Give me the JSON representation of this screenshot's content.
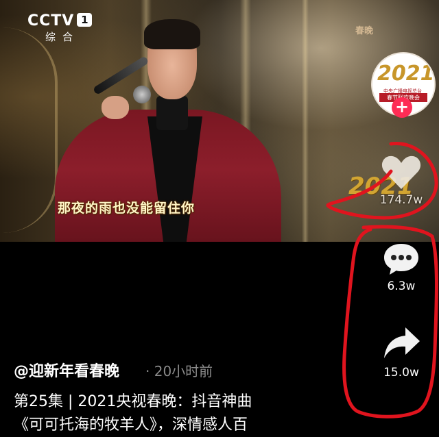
{
  "video": {
    "channel_logo": "CCTV",
    "channel_number": "1",
    "channel_sub": "综合",
    "watermark": "春晚",
    "subtitle": "那夜的雨也没能留住你",
    "gala_logo_text": "2021"
  },
  "sidebar": {
    "avatar_year": "2021",
    "avatar_caption": "中央广播电视总台",
    "avatar_banner": "春节联欢晚会",
    "follow_symbol": "+",
    "like_count": "174.7w",
    "comment_count": "6.3w",
    "share_count": "15.0w"
  },
  "caption": {
    "author": "@迎新年看春晚",
    "time": "· 20小时前",
    "description_line1": "第25集 | 2021央视春晚：抖音神曲",
    "description_line2": "《可可托海的牧羊人》，深情感人百"
  },
  "colors": {
    "accent_pink": "#fe2c55",
    "annotation_red": "#e0141e",
    "muted_gray": "#8a8a8a"
  },
  "icons": [
    "heart-icon",
    "comment-bubble-icon",
    "share-arrow-icon",
    "plus-icon"
  ]
}
